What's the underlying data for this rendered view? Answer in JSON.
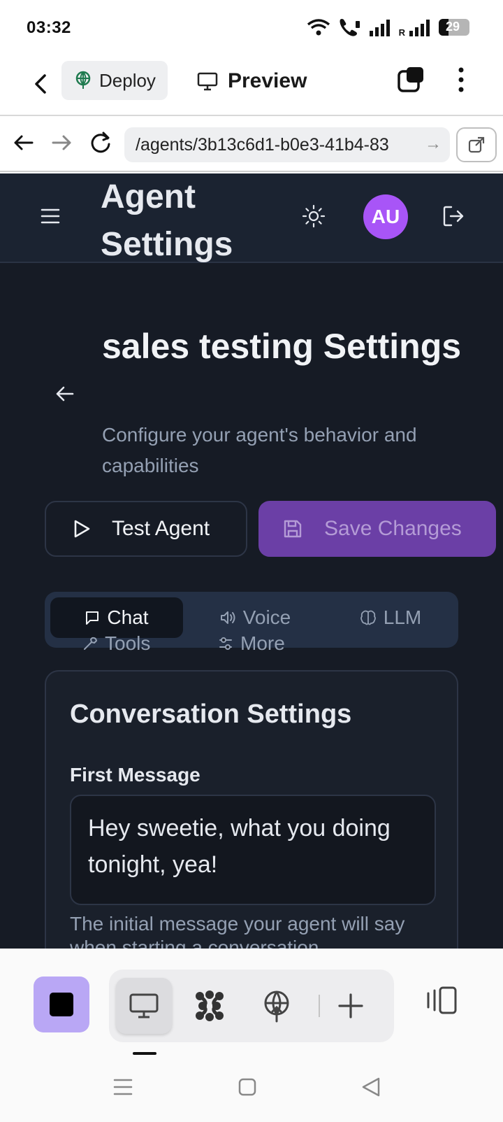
{
  "status_bar": {
    "time": "03:32",
    "battery": "29",
    "carrier_tag": "R"
  },
  "browser": {
    "deploy_label": "Deploy",
    "preview_label": "Preview",
    "url": "/agents/3b13c6d1-b0e3-41b4-83"
  },
  "app": {
    "header_title": "Agent Settings",
    "avatar_initials": "AU",
    "page_title": "sales testing Settings",
    "page_subtitle": "Configure your agent's behavior and capabilities",
    "test_button": "Test Agent",
    "save_button": "Save Changes",
    "tabs": [
      {
        "label": "Chat",
        "active": true
      },
      {
        "label": "Voice",
        "active": false
      },
      {
        "label": "LLM",
        "active": false
      },
      {
        "label": "Tools",
        "active": false
      },
      {
        "label": "More",
        "active": false
      }
    ],
    "card": {
      "title": "Conversation Settings",
      "first_message_label": "First Message",
      "first_message_value": "Hey sweetie, what you doing tonight, yea!",
      "first_message_help": "The initial message your agent will say when starting a conversation"
    }
  },
  "colors": {
    "app_bg": "#161b25",
    "accent_purple": "#6b3fa6",
    "avatar": "#a855f7",
    "home_button": "#b9a7f5"
  }
}
